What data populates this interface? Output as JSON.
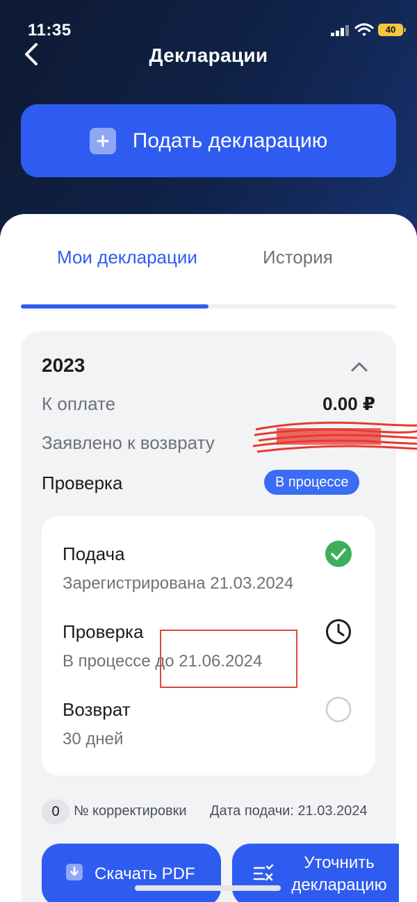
{
  "status_bar": {
    "time": "11:35",
    "battery": "40"
  },
  "nav": {
    "title": "Декларации"
  },
  "submit_button": {
    "label": "Подать декларацию"
  },
  "tabs": [
    {
      "label": "Мои декларации",
      "active": true
    },
    {
      "label": "История",
      "active": false
    }
  ],
  "declaration": {
    "year": "2023",
    "to_pay_label": "К оплате",
    "to_pay_value": "0.00 ₽",
    "refund_label": "Заявлено к возврату",
    "check_label": "Проверка",
    "check_status": "В процессе",
    "steps": [
      {
        "title": "Подача",
        "subtitle": "Зарегистрирована 21.03.2024",
        "state": "done",
        "icon": "check-circle-icon"
      },
      {
        "title": "Проверка",
        "subtitle": "В процессе до 21.06.2024",
        "state": "in-progress",
        "icon": "clock-icon"
      },
      {
        "title": "Возврат",
        "subtitle": "30 дней",
        "state": "pending",
        "icon": "empty-circle-icon"
      }
    ],
    "correction_count": "0",
    "correction_label": "№ корректировки",
    "submission_date": "Дата подачи: 21.03.2024"
  },
  "actions": {
    "download_pdf": "Скачать PDF",
    "refine_line1": "Уточнить",
    "refine_line2": "декларацию"
  },
  "colors": {
    "accent": "#2f5cf0",
    "header_bg": "#102249",
    "success": "#3cae5c",
    "annotation": "#e0473a"
  }
}
